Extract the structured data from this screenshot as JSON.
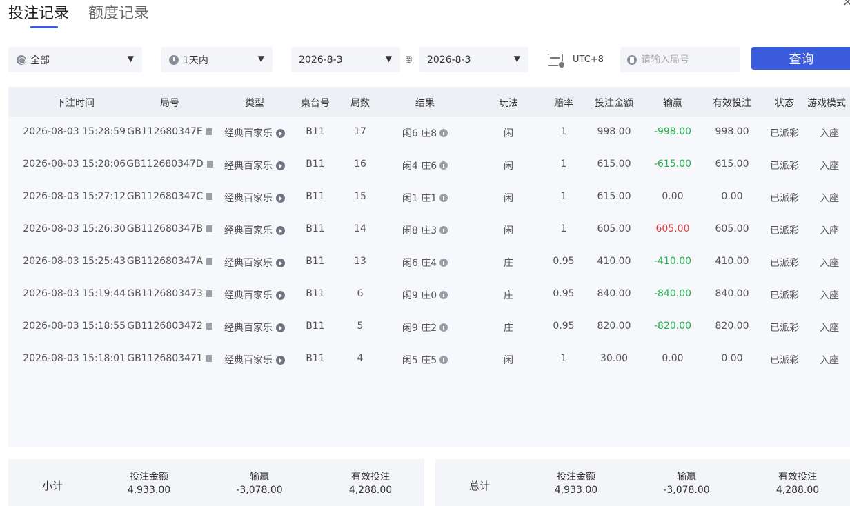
{
  "tabs": [
    "投注记录",
    "额度记录"
  ],
  "close_glyph": "×",
  "filters": {
    "category": "全部",
    "time_range": "1天内",
    "date_from": "2026-8-3",
    "to_label": "到",
    "date_to": "2026-8-3",
    "timezone": "UTC+8",
    "round_placeholder": "请输入局号",
    "query_label": "查询",
    "caret": "▼"
  },
  "table": {
    "headers": [
      "下注时间",
      "局号",
      "类型",
      "桌台号",
      "局数",
      "结果",
      "玩法",
      "赔率",
      "投注金额",
      "输赢",
      "有效投注",
      "状态",
      "游戏模式"
    ],
    "rows": [
      {
        "time": "2026-08-03 15:28:59",
        "round": "GB112680347E",
        "type": "经典百家乐",
        "table": "B11",
        "count": "17",
        "result": "闲6 庄8",
        "play": "闲",
        "odds": "1",
        "bet": "998.00",
        "winloss": "-998.00",
        "valid": "998.00",
        "status": "已派彩",
        "mode": "入座"
      },
      {
        "time": "2026-08-03 15:28:06",
        "round": "GB112680347D",
        "type": "经典百家乐",
        "table": "B11",
        "count": "16",
        "result": "闲4 庄6",
        "play": "闲",
        "odds": "1",
        "bet": "615.00",
        "winloss": "-615.00",
        "valid": "615.00",
        "status": "已派彩",
        "mode": "入座"
      },
      {
        "time": "2026-08-03 15:27:12",
        "round": "GB112680347C",
        "type": "经典百家乐",
        "table": "B11",
        "count": "15",
        "result": "闲1 庄1",
        "play": "闲",
        "odds": "1",
        "bet": "615.00",
        "winloss": "0.00",
        "valid": "0.00",
        "status": "已派彩",
        "mode": "入座"
      },
      {
        "time": "2026-08-03 15:26:30",
        "round": "GB112680347B",
        "type": "经典百家乐",
        "table": "B11",
        "count": "14",
        "result": "闲8 庄3",
        "play": "闲",
        "odds": "1",
        "bet": "605.00",
        "winloss": "605.00",
        "valid": "605.00",
        "status": "已派彩",
        "mode": "入座"
      },
      {
        "time": "2026-08-03 15:25:43",
        "round": "GB112680347A",
        "type": "经典百家乐",
        "table": "B11",
        "count": "13",
        "result": "闲6 庄4",
        "play": "庄",
        "odds": "0.95",
        "bet": "410.00",
        "winloss": "-410.00",
        "valid": "410.00",
        "status": "已派彩",
        "mode": "入座"
      },
      {
        "time": "2026-08-03 15:19:44",
        "round": "GB1126803473",
        "type": "经典百家乐",
        "table": "B11",
        "count": "6",
        "result": "闲9 庄0",
        "play": "庄",
        "odds": "0.95",
        "bet": "840.00",
        "winloss": "-840.00",
        "valid": "840.00",
        "status": "已派彩",
        "mode": "入座"
      },
      {
        "time": "2026-08-03 15:18:55",
        "round": "GB1126803472",
        "type": "经典百家乐",
        "table": "B11",
        "count": "5",
        "result": "闲9 庄2",
        "play": "庄",
        "odds": "0.95",
        "bet": "820.00",
        "winloss": "-820.00",
        "valid": "820.00",
        "status": "已派彩",
        "mode": "入座"
      },
      {
        "time": "2026-08-03 15:18:01",
        "round": "GB1126803471",
        "type": "经典百家乐",
        "table": "B11",
        "count": "4",
        "result": "闲5 庄5",
        "play": "闲",
        "odds": "1",
        "bet": "30.00",
        "winloss": "0.00",
        "valid": "0.00",
        "status": "已派彩",
        "mode": "入座"
      }
    ]
  },
  "subtotal": {
    "label": "小计",
    "bet_label": "投注金额",
    "bet": "4,933.00",
    "winloss_label": "输赢",
    "winloss": "-3,078.00",
    "valid_label": "有效投注",
    "valid": "4,288.00"
  },
  "total": {
    "label": "总计",
    "bet_label": "投注金额",
    "bet": "4,933.00",
    "winloss_label": "输赢",
    "winloss": "-3,078.00",
    "valid_label": "有效投注",
    "valid": "4,288.00"
  },
  "colors": {
    "accent": "#3a5bdc",
    "loss": "#22b04b",
    "win": "#e23c3c"
  }
}
